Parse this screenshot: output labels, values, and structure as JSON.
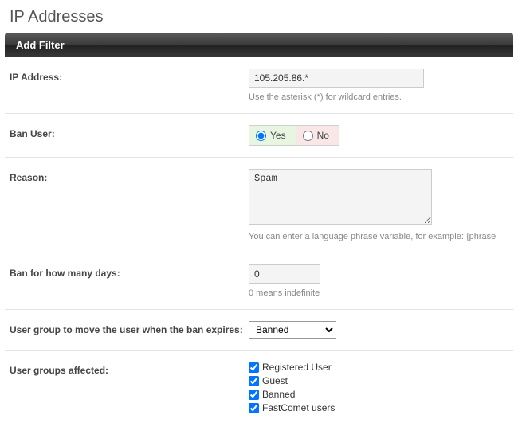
{
  "page_title": "IP Addresses",
  "section_header": "Add Filter",
  "fields": {
    "ip_address": {
      "label": "IP Address:",
      "value": "105.205.86.*",
      "hint": "Use the asterisk (*) for wildcard entries."
    },
    "ban_user": {
      "label": "Ban User:",
      "yes_label": "Yes",
      "no_label": "No",
      "value": "yes"
    },
    "reason": {
      "label": "Reason:",
      "value": "Spam",
      "hint": "You can enter a language phrase variable, for example: {phrase"
    },
    "ban_days": {
      "label": "Ban for how many days:",
      "value": "0",
      "hint": "0 means indefinite"
    },
    "expire_group": {
      "label": "User group to move the user when the ban expires:",
      "selected": "Banned"
    },
    "groups_affected": {
      "label": "User groups affected:",
      "items": [
        {
          "label": "Registered User",
          "checked": true
        },
        {
          "label": "Guest",
          "checked": true
        },
        {
          "label": "Banned",
          "checked": true
        },
        {
          "label": "FastComet users",
          "checked": true
        }
      ]
    }
  }
}
